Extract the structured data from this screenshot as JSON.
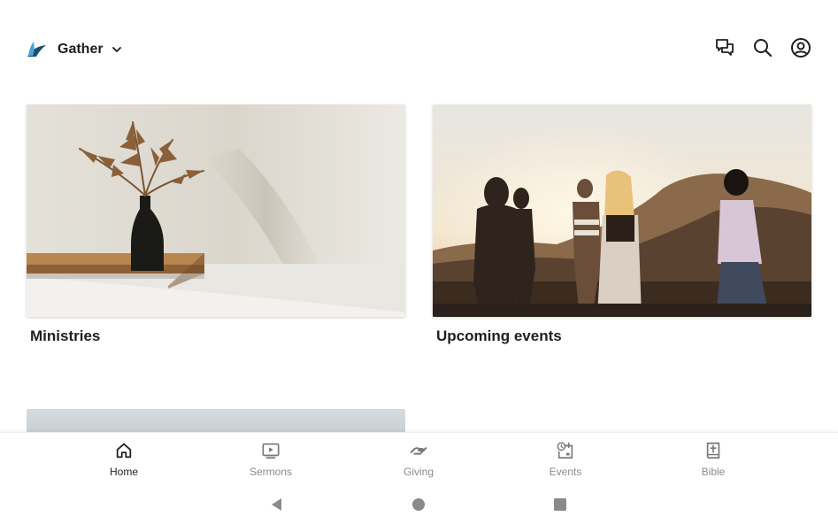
{
  "header": {
    "app_name": "Gather",
    "logo_icon": "gather-leaf-logo",
    "actions": [
      {
        "name": "messages-icon"
      },
      {
        "name": "search-icon"
      },
      {
        "name": "account-icon"
      }
    ]
  },
  "cards": [
    {
      "title": "Ministries",
      "image": "vase-with-dried-leaves-on-shelf"
    },
    {
      "title": "Upcoming events",
      "image": "people-at-sunset-on-hill"
    },
    {
      "title": "",
      "image": "partially-visible-card"
    }
  ],
  "bottom_nav": {
    "active": "Home",
    "items": [
      {
        "label": "Home",
        "icon": "home-icon"
      },
      {
        "label": "Sermons",
        "icon": "sermons-play-icon"
      },
      {
        "label": "Giving",
        "icon": "giving-hand-icon"
      },
      {
        "label": "Events",
        "icon": "events-calendar-icon"
      },
      {
        "label": "Bible",
        "icon": "bible-book-icon"
      }
    ]
  },
  "system_nav": {
    "buttons": [
      "back-icon",
      "home-circle-icon",
      "recents-square-icon"
    ]
  },
  "colors": {
    "logo_dark": "#1b4f72",
    "logo_light": "#4aa3d8",
    "text_primary": "#1f1f1f",
    "text_secondary": "#8a8a8a"
  }
}
